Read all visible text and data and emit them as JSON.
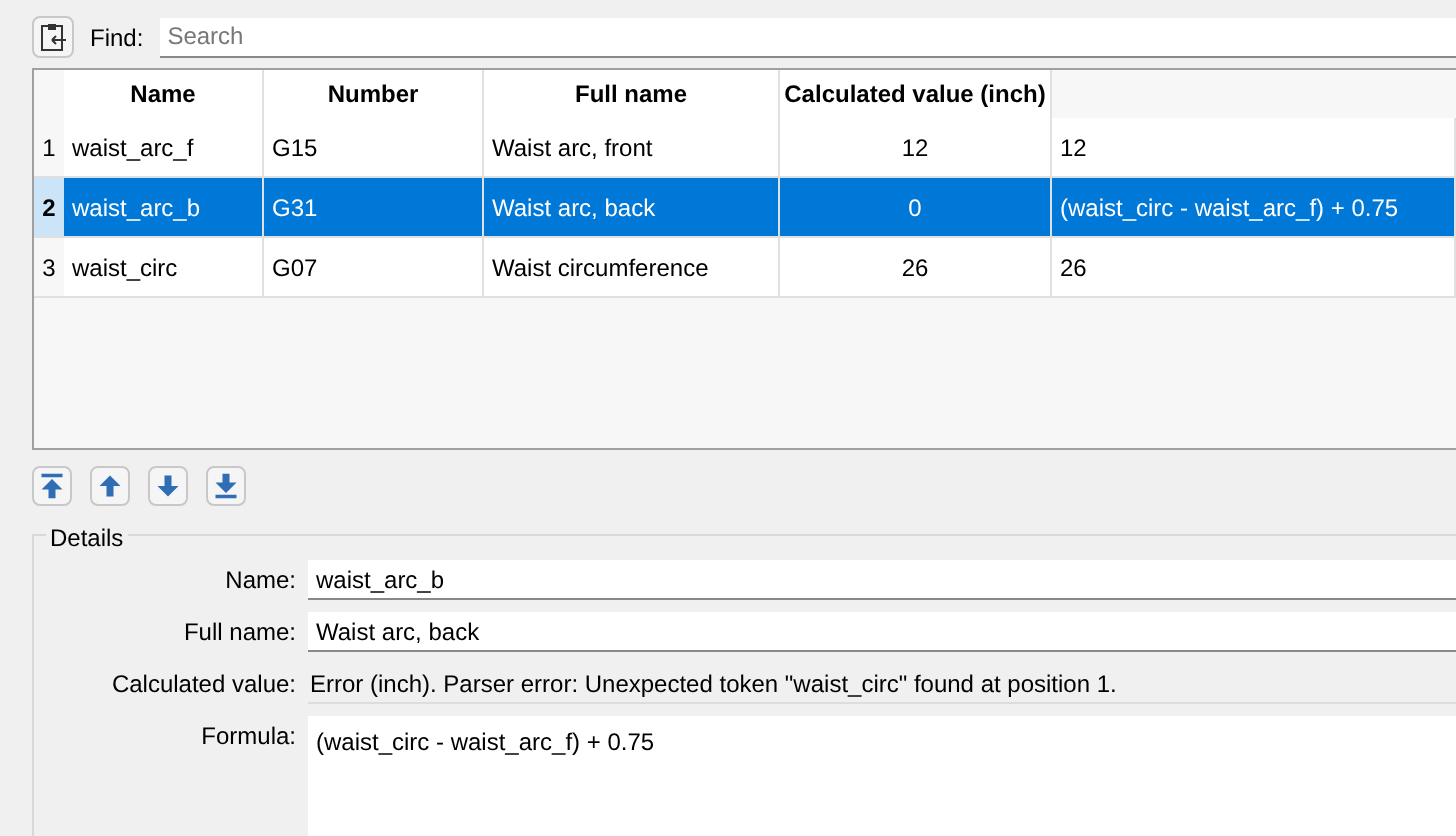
{
  "toolbar": {
    "find_label": "Find:",
    "search": {
      "placeholder": "Search"
    }
  },
  "table": {
    "columns": [
      "Name",
      "Number",
      "Full name",
      "Calculated value (inch)"
    ],
    "rows": [
      {
        "index": "1",
        "name": "waist_arc_f",
        "number": "G15",
        "full_name": "Waist arc, front",
        "value": "12",
        "formula": "12",
        "selected": false
      },
      {
        "index": "2",
        "name": "waist_arc_b",
        "number": "G31",
        "full_name": "Waist arc, back",
        "value": "0",
        "formula": "(waist_circ - waist_arc_f) + 0.75",
        "selected": true
      },
      {
        "index": "3",
        "name": "waist_circ",
        "number": "G07",
        "full_name": "Waist circumference",
        "value": "26",
        "formula": "26",
        "selected": false
      }
    ]
  },
  "move_buttons": [
    {
      "kind": "top"
    },
    {
      "kind": "up"
    },
    {
      "kind": "down"
    },
    {
      "kind": "bottom"
    }
  ],
  "details": {
    "title": "Details",
    "name": {
      "label": "Name:",
      "value": "waist_arc_b"
    },
    "full_name": {
      "label": "Full name:",
      "value": "Waist arc, back"
    },
    "calculated": {
      "label": "Calculated value:",
      "value": "Error (inch). Parser error: Unexpected token \"waist_circ\" found at position 1."
    },
    "formula": {
      "label": "Formula:",
      "value": "(waist_circ - waist_arc_f) + 0.75"
    }
  }
}
